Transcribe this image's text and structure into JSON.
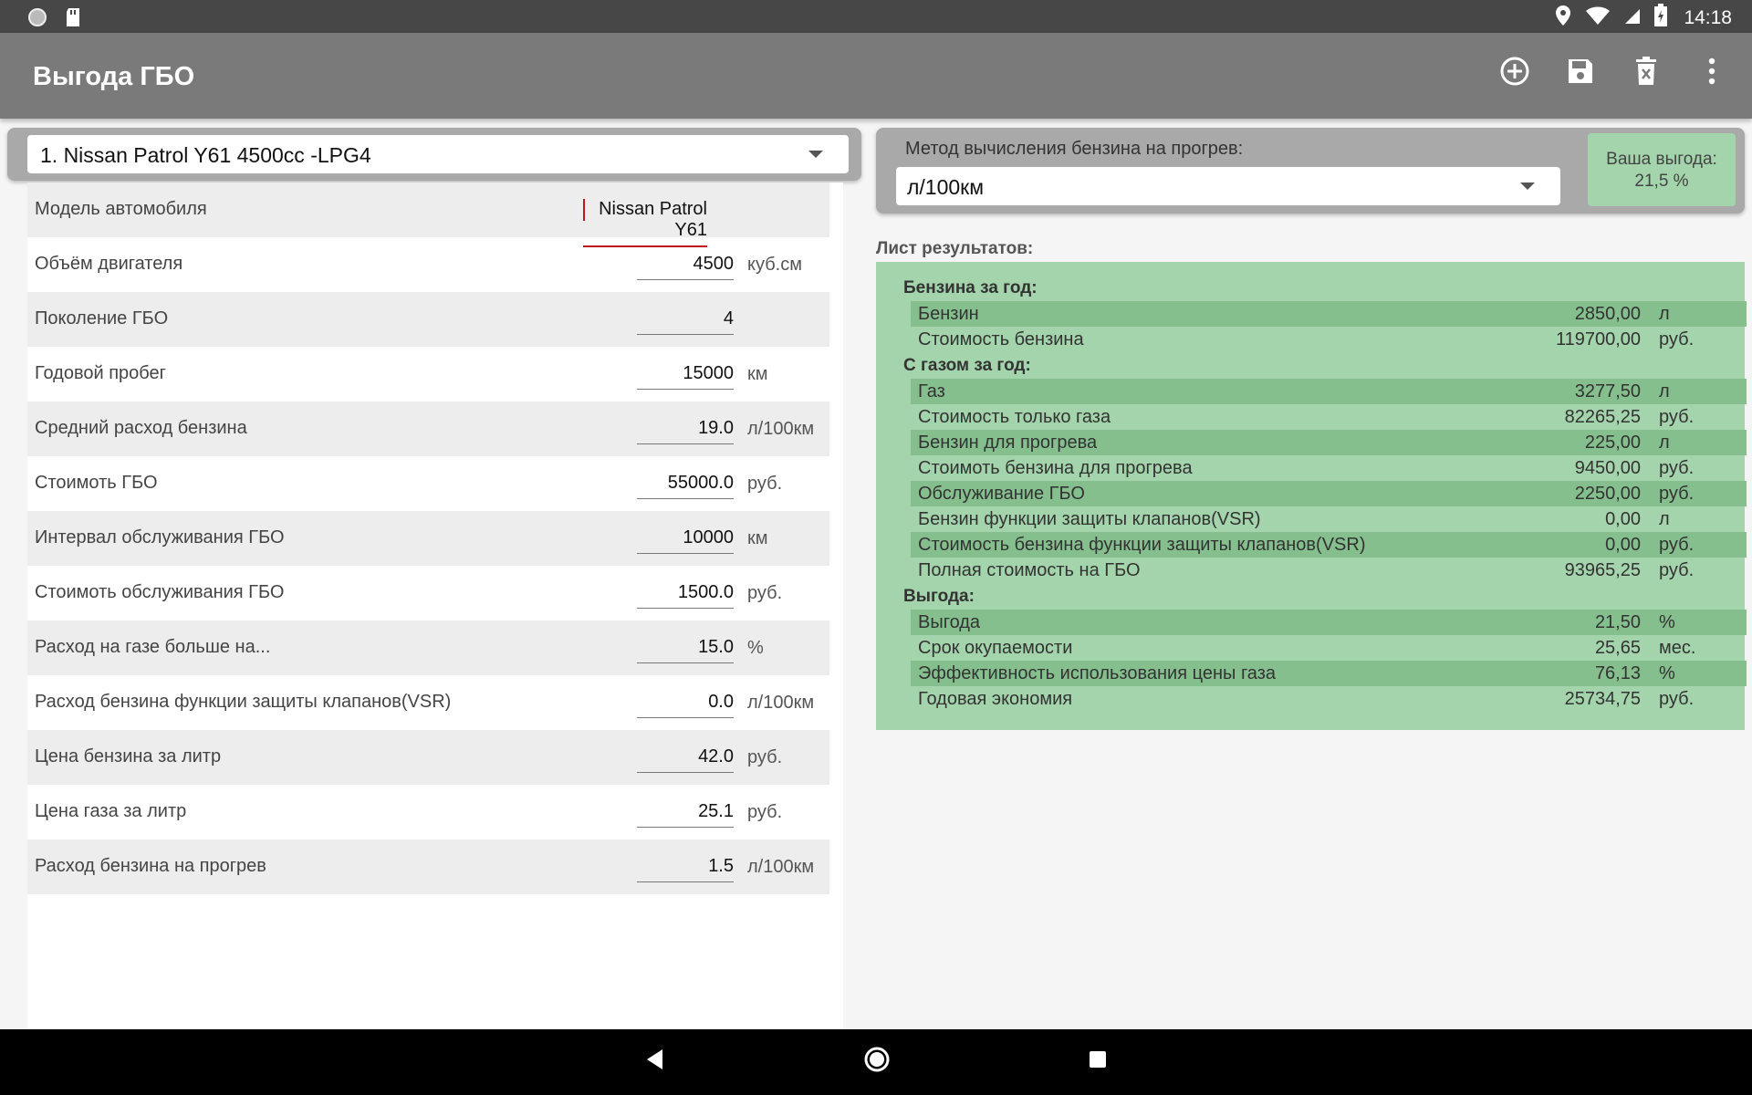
{
  "status_bar": {
    "time": "14:18"
  },
  "app_bar": {
    "title": "Выгода ГБО",
    "actions": [
      "add-circle-icon",
      "save-icon",
      "delete-icon",
      "more-vert-icon"
    ]
  },
  "car_select": {
    "value": "1. Nissan Patrol Y61  4500cc  -LPG4"
  },
  "fields": [
    {
      "label": "Модель автомобиля",
      "value": "Nissan Patrol Y61",
      "unit": ""
    },
    {
      "label": "Объём двигателя",
      "value": "4500",
      "unit": "куб.см"
    },
    {
      "label": "Поколение ГБО",
      "value": "4",
      "unit": ""
    },
    {
      "label": "Годовой пробег",
      "value": "15000",
      "unit": "км"
    },
    {
      "label": "Средний расход бензина",
      "value": "19.0",
      "unit": "л/100км"
    },
    {
      "label": "Стоимоть ГБО",
      "value": "55000.0",
      "unit": "руб."
    },
    {
      "label": "Интервал обслуживания ГБО",
      "value": "10000",
      "unit": "км"
    },
    {
      "label": "Стоимоть обслуживания ГБО",
      "value": "1500.0",
      "unit": "руб."
    },
    {
      "label": "Расход на газе больше на...",
      "value": "15.0",
      "unit": "%"
    },
    {
      "label": "Расход бензина функции защиты клапанов(VSR)",
      "value": "0.0",
      "unit": "л/100км"
    },
    {
      "label": "Цена бензина за литр",
      "value": "42.0",
      "unit": "руб."
    },
    {
      "label": "Цена газа за литр",
      "value": "25.1",
      "unit": "руб."
    },
    {
      "label": "Расход бензина на прогрев",
      "value": "1.5",
      "unit": "л/100км"
    }
  ],
  "method": {
    "label": "Метод вычисления бензина на прогрев:",
    "value": "л/100км"
  },
  "benefit": {
    "label": "Ваша выгода:",
    "value": "21,5 %"
  },
  "results": {
    "title": "Лист результатов:",
    "sections": [
      {
        "title": "Бензина за год:",
        "rows": [
          {
            "label": "Бензин",
            "value": "2850,00",
            "unit": "л"
          },
          {
            "label": "Стоимость бензина",
            "value": "119700,00",
            "unit": "руб."
          }
        ]
      },
      {
        "title": "С газом за год:",
        "rows": [
          {
            "label": "Газ",
            "value": "3277,50",
            "unit": "л"
          },
          {
            "label": "Стоимость только газа",
            "value": "82265,25",
            "unit": "руб."
          },
          {
            "label": "Бензин для прогрева",
            "value": "225,00",
            "unit": "л"
          },
          {
            "label": "Стоимоть бензина для прогрева",
            "value": "9450,00",
            "unit": "руб."
          },
          {
            "label": "Обслуживание ГБО",
            "value": "2250,00",
            "unit": "руб."
          },
          {
            "label": "Бензин функции защиты клапанов(VSR)",
            "value": "0,00",
            "unit": "л"
          },
          {
            "label": "Стоимость бензина функции защиты клапанов(VSR)",
            "value": "0,00",
            "unit": "руб."
          },
          {
            "label": "Полная стоимость на ГБО",
            "value": "93965,25",
            "unit": "руб."
          }
        ]
      },
      {
        "title": "Выгода:",
        "rows": [
          {
            "label": "Выгода",
            "value": "21,50",
            "unit": "%"
          },
          {
            "label": "Срок окупаемости",
            "value": "25,65",
            "unit": "мес."
          },
          {
            "label": "Эффективность использования цены газа",
            "value": "76,13",
            "unit": "%"
          },
          {
            "label": "Годовая экономия",
            "value": "25734,75",
            "unit": "руб."
          }
        ]
      }
    ]
  },
  "colors": {
    "app_bar": "#7a7a7a",
    "results_bg": "#a3d4ab",
    "results_row_shade": "#84bf8d",
    "accent": "#c0151b"
  }
}
